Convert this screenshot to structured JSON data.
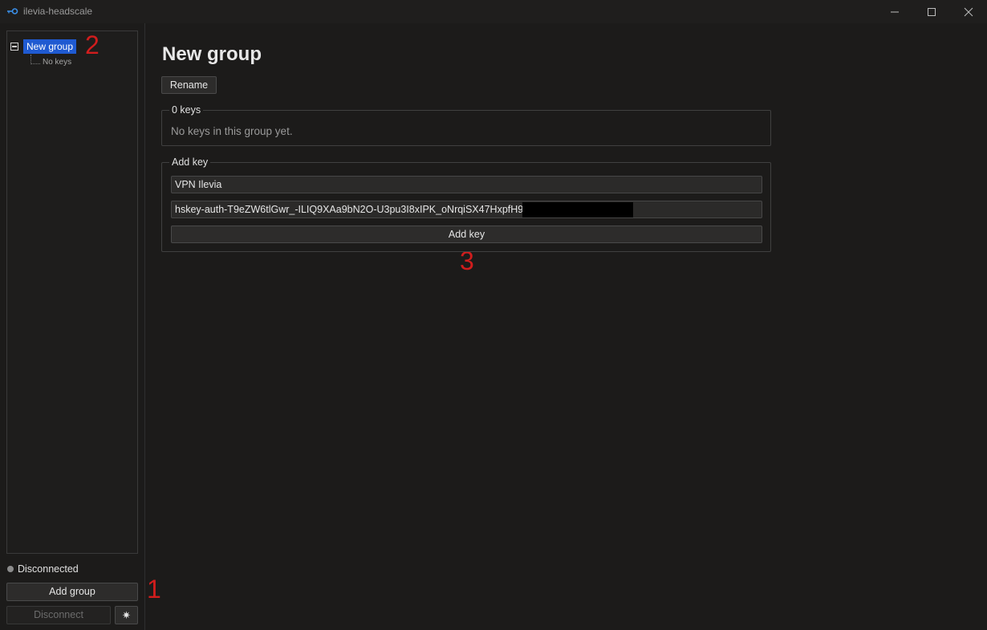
{
  "window": {
    "title": "ilevia-headscale",
    "icon": "key-icon"
  },
  "sidebar": {
    "tree": {
      "group_label": "New group",
      "child_label": "No keys"
    },
    "status": {
      "text": "Disconnected",
      "dot_color": "#8c8c8c"
    },
    "add_group_label": "Add group",
    "disconnect_label": "Disconnect",
    "settings_symbol": "✷"
  },
  "main": {
    "title": "New group",
    "rename_label": "Rename",
    "keys_section": {
      "legend": "0 keys",
      "empty_text": "No keys in this group yet."
    },
    "add_key_section": {
      "legend": "Add key",
      "name_value": "VPN Ilevia",
      "key_value": "hskey-auth-T9eZW6tlGwr_-ILIQ9XAa9bN2O-U3pu3I8xIPK_oNrqiSX47HxpfH9ZFqJ",
      "button_label": "Add key"
    }
  },
  "annotations": [
    "1",
    "2",
    "3"
  ],
  "colors": {
    "background": "#1c1b1a",
    "selection": "#1f5ad1",
    "annotation": "#d11d1d"
  }
}
